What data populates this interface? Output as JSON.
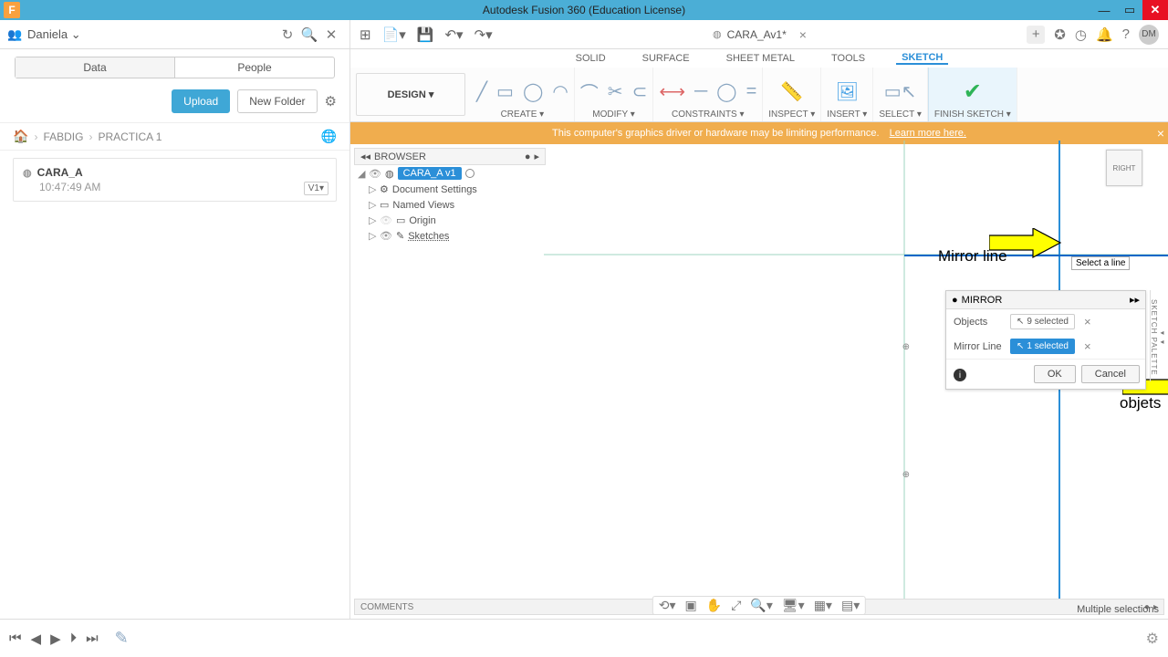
{
  "title_bar": {
    "app_title": "Autodesk Fusion 360 (Education License)",
    "app_icon_letter": "F"
  },
  "user_menu": {
    "name": "Daniela"
  },
  "quick_access": {
    "grid": "⊞",
    "new": "📄",
    "save": "💾",
    "undo": "↶",
    "redo": "↷"
  },
  "doc_tab": {
    "label": "CARA_Av1*"
  },
  "right_icons": {
    "avatar": "DM"
  },
  "data_panel": {
    "seg_data": "Data",
    "seg_people": "People",
    "upload": "Upload",
    "newfolder": "New Folder",
    "crumb1": "FABDIG",
    "crumb2": "PRACTICA 1",
    "file_name": "CARA_A",
    "file_time": "10:47:49 AM",
    "file_ver": "V1▾"
  },
  "workspace_tabs": {
    "solid": "SOLID",
    "surface": "SURFACE",
    "sheet": "SHEET METAL",
    "tools": "TOOLS",
    "sketch": "SKETCH"
  },
  "ribbon": {
    "design": "DESIGN ▾",
    "create": "CREATE ▾",
    "modify": "MODIFY ▾",
    "constraints": "CONSTRAINTS ▾",
    "inspect": "INSPECT ▾",
    "insert": "INSERT ▾",
    "select": "SELECT ▾",
    "finish": "FINISH SKETCH ▾"
  },
  "banner": {
    "text": "This computer's graphics driver or hardware may be limiting performance.",
    "link": "Learn more here."
  },
  "browser": {
    "title": "BROWSER",
    "root": "CARA_A v1",
    "n1": "Document Settings",
    "n2": "Named Views",
    "n3": "Origin",
    "n4": "Sketches"
  },
  "tooltip": "Select a line",
  "annot_mirror": "Mirror line",
  "annot_objects": "objets",
  "mirror": {
    "title": "MIRROR",
    "objects_label": "Objects",
    "objects_sel": "9 selected",
    "line_label": "Mirror Line",
    "line_sel": "1 selected",
    "ok": "OK",
    "cancel": "Cancel"
  },
  "palette": "SKETCH PALETTE",
  "viewcube": "RIGHT",
  "comments": "COMMENTS",
  "status": "Multiple selections"
}
